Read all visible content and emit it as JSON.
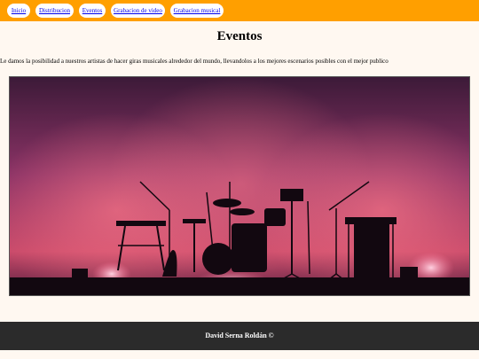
{
  "nav": {
    "items": [
      {
        "label": "Inicio"
      },
      {
        "label": "Distribucion"
      },
      {
        "label": "Eventos"
      },
      {
        "label": "Grabacion de video"
      },
      {
        "label": "Grabacion musical"
      }
    ]
  },
  "main": {
    "title": "Eventos",
    "description": "Le damos la posibilidad a nuestros artistas de hacer giras musicales alrededor del mundo, llevandolos a los mejores escenarios posibles con el mejor publico"
  },
  "hero": {
    "subject": "concert-stage-image"
  },
  "footer": {
    "text": "David Serna Roldán ©"
  },
  "colors": {
    "navbar": "#ff9f00",
    "page_background": "#fff8f1",
    "footer": "#2b2b2b",
    "link": "#0000ee"
  }
}
